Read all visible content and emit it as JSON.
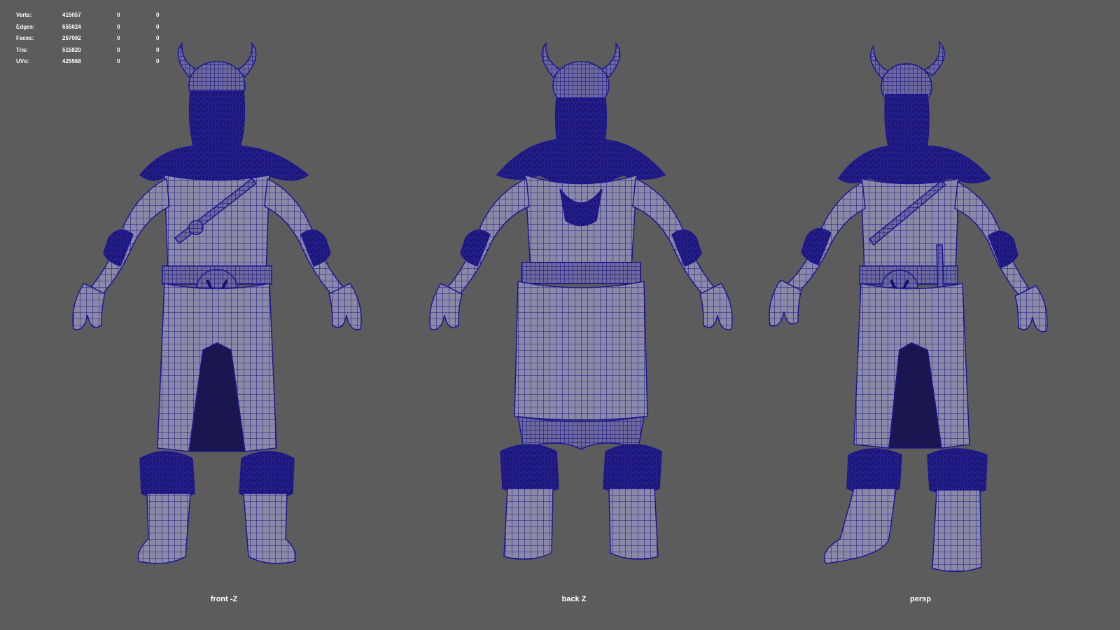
{
  "hud": {
    "rows": [
      {
        "label": "Verts:",
        "count": "415057",
        "selected": "0",
        "components": "0"
      },
      {
        "label": "Edges:",
        "count": "655024",
        "selected": "0",
        "components": "0"
      },
      {
        "label": "Faces:",
        "count": "257992",
        "selected": "0",
        "components": "0"
      },
      {
        "label": "Tris:",
        "count": "515820",
        "selected": "0",
        "components": "0"
      },
      {
        "label": "UVs:",
        "count": "425568",
        "selected": "0",
        "components": "0"
      }
    ]
  },
  "views": [
    {
      "label": "front -Z",
      "camera": "front"
    },
    {
      "label": "back Z",
      "camera": "back"
    },
    {
      "label": "persp",
      "camera": "persp"
    }
  ],
  "colors": {
    "background": "#5c5c5c",
    "wireframe": "#1d178f",
    "surface": "#8b8aa6",
    "hud_text": "#ffffff"
  }
}
